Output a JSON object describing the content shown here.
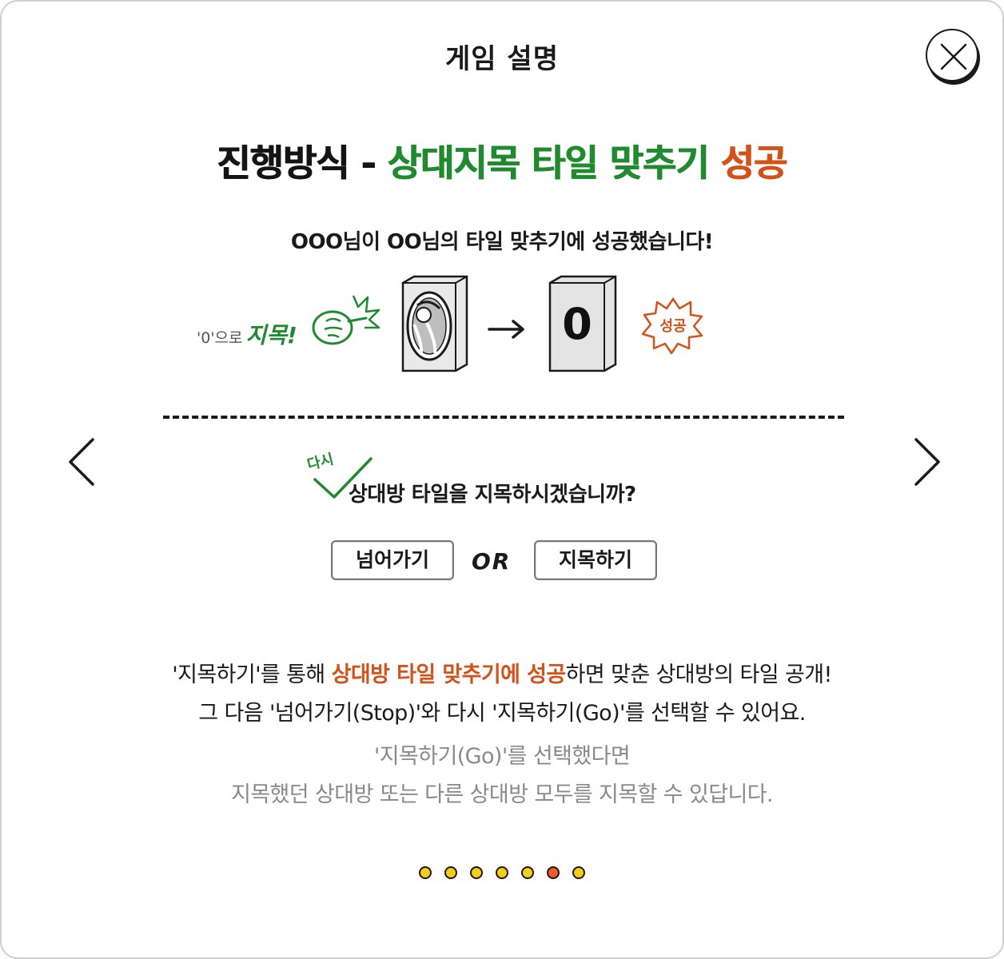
{
  "modal": {
    "title": "게임 설명",
    "close_icon": "close-icon"
  },
  "headline": {
    "part1": "진행방식 - ",
    "part2": "상대지목 타일 맞추기 ",
    "part3": "성공",
    "colors": {
      "dark": "#141414",
      "green": "#1f8a2e",
      "orange": "#d2521a"
    }
  },
  "subtitle": "OOO님이 OO님의 타일 맞추기에 성공했습니다!",
  "illustration": {
    "point_prefix": "'0'으로",
    "point_word": "지목!",
    "card_value": "0",
    "success_text": "성공",
    "icons": [
      "pointing-fist-icon",
      "card-back-icon",
      "arrow-right-icon",
      "card-front-icon",
      "burst-icon"
    ]
  },
  "again_mark": "다시",
  "question": "상대방 타일을 지목하시겠습니까?",
  "choices": {
    "skip_label": "넘어가기",
    "or_label": "OR",
    "point_label": "지목하기"
  },
  "description": {
    "line1_a": "'지목하기'를 통해 ",
    "line1_hl": "상대방 타일 맞추기에 성공",
    "line1_b": "하면 맞춘 상대방의 타일 공개!",
    "line2": "그 다음 '넘어가기(Stop)'와 다시 '지목하기(Go)'를 선택할 수 있어요.",
    "line3": "'지목하기(Go)'를 선택했다면",
    "line4": "지목했던 상대방 또는 다른 상대방 모두를 지목할 수 있답니다."
  },
  "pagination": {
    "total": 7,
    "current": 6,
    "colors": {
      "inactive": "#f6cd1a",
      "active": "#f05a28"
    }
  }
}
